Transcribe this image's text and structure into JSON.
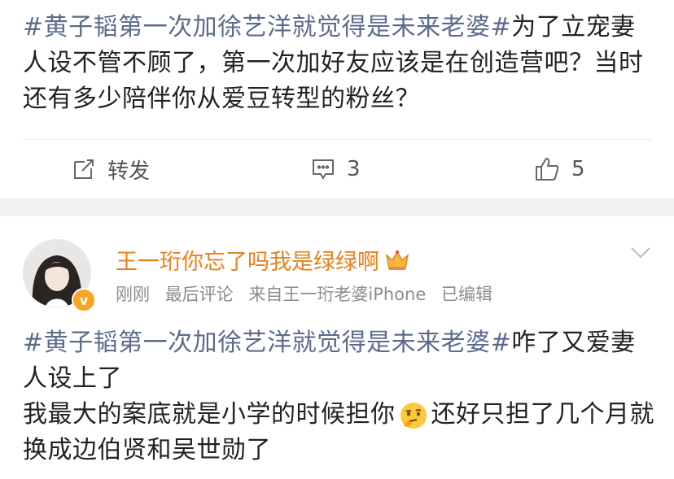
{
  "post1": {
    "hashtag": "#黄子韬第一次加徐艺洋就觉得是未来老婆#",
    "text": "为了立宠妻人设不管不顾了，第一次加好友应该是在创造营吧？当时还有多少陪伴你从爱豆转型的粉丝？",
    "repost_label": "转发",
    "comment_count": "3",
    "like_count": "5",
    "icons": [
      "repost-icon",
      "comment-icon",
      "like-icon"
    ]
  },
  "post2": {
    "username": "王一珩你忘了吗我是绿绿啊",
    "badge": "v",
    "meta": {
      "time": "刚刚",
      "latest_comment": "最后评论",
      "source": "来自王一珩老婆iPhone",
      "edited": "已编辑"
    },
    "hashtag": "#黄子韬第一次加徐艺洋就觉得是未来老婆#",
    "text_line1_rest": "咋了又爱妻人设上了",
    "text_line2_before": "我最大的案底就是小学的时候担你",
    "text_line2_after": "还好只担了几个月就换成边伯贤和吴世勋了",
    "icons": [
      "crown-icon",
      "chevron-down-icon",
      "thinking-emoji-icon",
      "verified-badge-icon"
    ]
  },
  "colors": {
    "hashtag": "#5b6b8c",
    "username": "#e8801c",
    "meta": "#8c8c8c",
    "badge": "#f5a623",
    "divider": "#f2f2f2"
  }
}
